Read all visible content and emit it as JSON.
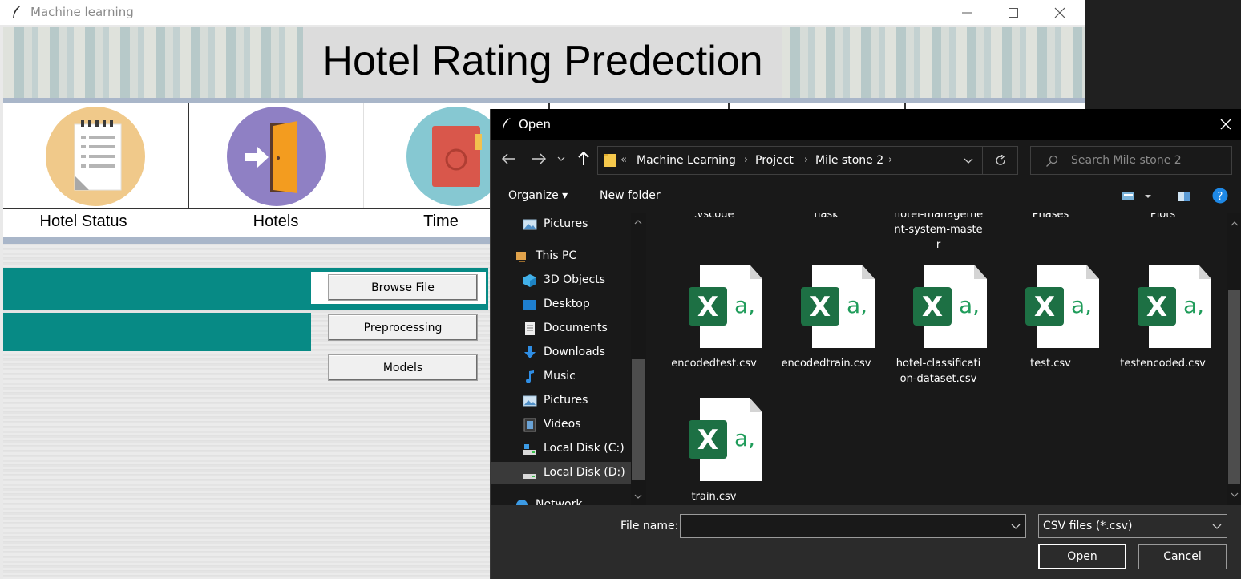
{
  "app": {
    "window_title": "Machine learning",
    "banner_title": "Hotel Rating Predection",
    "categories": [
      {
        "label": "Hotel Status",
        "icon": "notepad-icon",
        "circle_color": "#f0c98a"
      },
      {
        "label": "Hotels",
        "icon": "door-icon",
        "circle_color": "#8f80c4"
      },
      {
        "label": "Time",
        "icon": "book-icon",
        "circle_color": "#86c8d2"
      }
    ],
    "buttons": {
      "browse": "Browse File",
      "preprocessing": "Preprocessing",
      "models": "Models"
    },
    "accent_color": "#078a85"
  },
  "dialog": {
    "title": "Open",
    "breadcrumb": [
      "Machine Learning",
      "Project",
      "Mile stone 2"
    ],
    "breadcrumb_prefix": "«",
    "search_placeholder": "Search Mile stone 2",
    "commands": {
      "organize": "Organize ▾",
      "new_folder": "New folder"
    },
    "nav_items": [
      {
        "label": "Pictures",
        "icon": "pictures-icon"
      },
      {
        "label": "This PC",
        "icon": "this-pc-icon"
      },
      {
        "label": "3D Objects",
        "icon": "3d-objects-icon"
      },
      {
        "label": "Desktop",
        "icon": "desktop-icon"
      },
      {
        "label": "Documents",
        "icon": "documents-icon"
      },
      {
        "label": "Downloads",
        "icon": "downloads-icon"
      },
      {
        "label": "Music",
        "icon": "music-icon"
      },
      {
        "label": "Pictures",
        "icon": "pictures-icon"
      },
      {
        "label": "Videos",
        "icon": "videos-icon"
      },
      {
        "label": "Local Disk (C:)",
        "icon": "drive-icon"
      },
      {
        "label": "Local Disk (D:)",
        "icon": "drive-icon",
        "selected": true
      },
      {
        "label": "Network",
        "icon": "network-icon"
      }
    ],
    "folders": [
      {
        "lines": [
          ".vscode"
        ]
      },
      {
        "lines": [
          "flask"
        ]
      },
      {
        "lines": [
          "hotel-manageme",
          "nt-system-maste",
          "r"
        ]
      },
      {
        "lines": [
          "Phases"
        ]
      },
      {
        "lines": [
          "Plots"
        ]
      }
    ],
    "files": [
      {
        "lines": [
          "encodedtest.csv"
        ]
      },
      {
        "lines": [
          "encodedtrain.csv"
        ]
      },
      {
        "lines": [
          "hotel-classificati",
          "on-dataset.csv"
        ]
      },
      {
        "lines": [
          "test.csv"
        ]
      },
      {
        "lines": [
          "testencoded.csv"
        ]
      },
      {
        "lines": [
          "train.csv"
        ]
      }
    ],
    "file_name_label": "File name:",
    "file_name_value": "",
    "file_type": "CSV files (*.csv)",
    "open_button": "Open",
    "cancel_button": "Cancel"
  }
}
